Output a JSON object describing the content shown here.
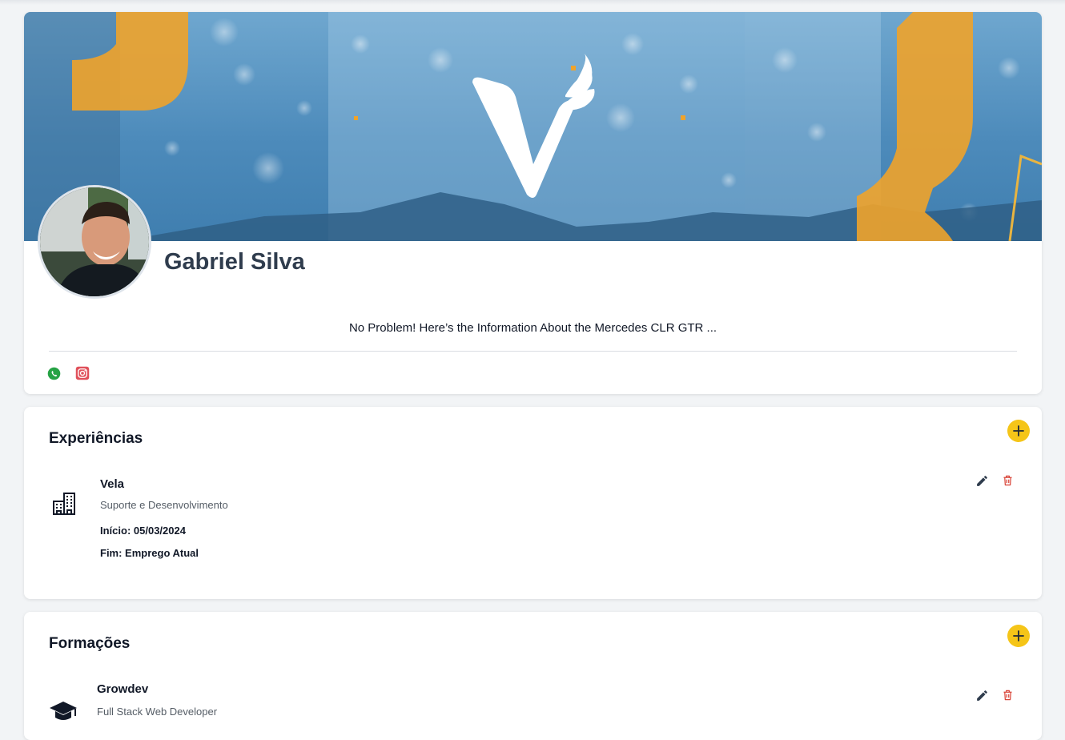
{
  "profile": {
    "name": "Gabriel Silva",
    "headline": "No Problem! Here’s the Information About the Mercedes CLR GTR ...",
    "social": [
      {
        "name": "whatsapp",
        "icon": "whatsapp-icon",
        "color": "#25a244"
      },
      {
        "name": "instagram",
        "icon": "instagram-icon",
        "color": "#e1306c"
      }
    ],
    "banner_icon": "vela-logo",
    "accent_color": "#f5c518"
  },
  "experiences": {
    "title": "Experiências",
    "items": [
      {
        "company": "Vela",
        "role": "Suporte e Desenvolvimento",
        "start": "Início: 05/03/2024",
        "end": "Fim: Emprego Atual",
        "icon": "building-icon"
      }
    ]
  },
  "education": {
    "title": "Formações",
    "items": [
      {
        "institution": "Growdev",
        "course": "Full Stack Web Developer",
        "icon": "graduation-cap-icon"
      }
    ]
  }
}
